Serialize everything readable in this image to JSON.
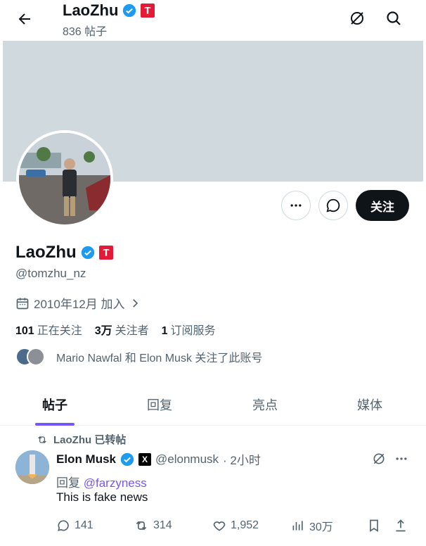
{
  "header": {
    "name": "LaoZhu",
    "post_count": "836 帖子"
  },
  "profile": {
    "name": "LaoZhu",
    "handle": "@tomzhu_nz",
    "joined": "2010年12月 加入",
    "stats": [
      {
        "value": "101",
        "label": "正在关注"
      },
      {
        "value": "3万",
        "label": "关注者"
      },
      {
        "value": "1",
        "label": "订阅服务"
      }
    ],
    "followed_by": "Mario Nawfal 和 Elon Musk 关注了此账号",
    "follow_label": "关注"
  },
  "tabs": [
    "帖子",
    "回复",
    "亮点",
    "媒体"
  ],
  "post": {
    "repost_label": "LaoZhu 已转帖",
    "author": "Elon Musk",
    "handle": "@elonmusk",
    "time": "· 2小时",
    "reply_prefix": "回复 ",
    "reply_to": "@farzyness",
    "text": "This is fake news",
    "replies": "141",
    "reposts": "314",
    "likes": "1,952",
    "views": "30万"
  },
  "colors": {
    "accent": "#7856ff",
    "verified": "#1d9bf0",
    "tesla_red": "#e31937"
  }
}
